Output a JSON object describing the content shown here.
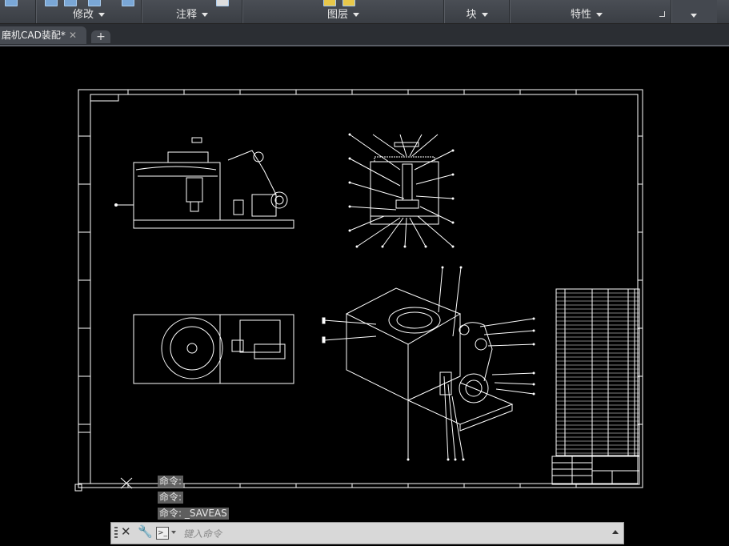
{
  "ribbon": {
    "panels": [
      {
        "label": "修改"
      },
      {
        "label": "注释"
      },
      {
        "label": "图层"
      },
      {
        "label": "块"
      },
      {
        "label": "特性"
      }
    ],
    "launcher_icon": "panel-launcher-arrow",
    "overflow_icon": "chevron-down-icon"
  },
  "tabs": {
    "file_tab": "磨机CAD装配*",
    "close_glyph": "✕",
    "new_tab_glyph": "+"
  },
  "command_history": [
    "命令:",
    "命令:",
    "命令: _SAVEAS"
  ],
  "command_line": {
    "placeholder": "键入命令",
    "prompt_icon": "command-prompt-icon"
  },
  "colors": {
    "background": "#000000",
    "lines": "#ffffff",
    "ribbon": "#3f434a"
  }
}
